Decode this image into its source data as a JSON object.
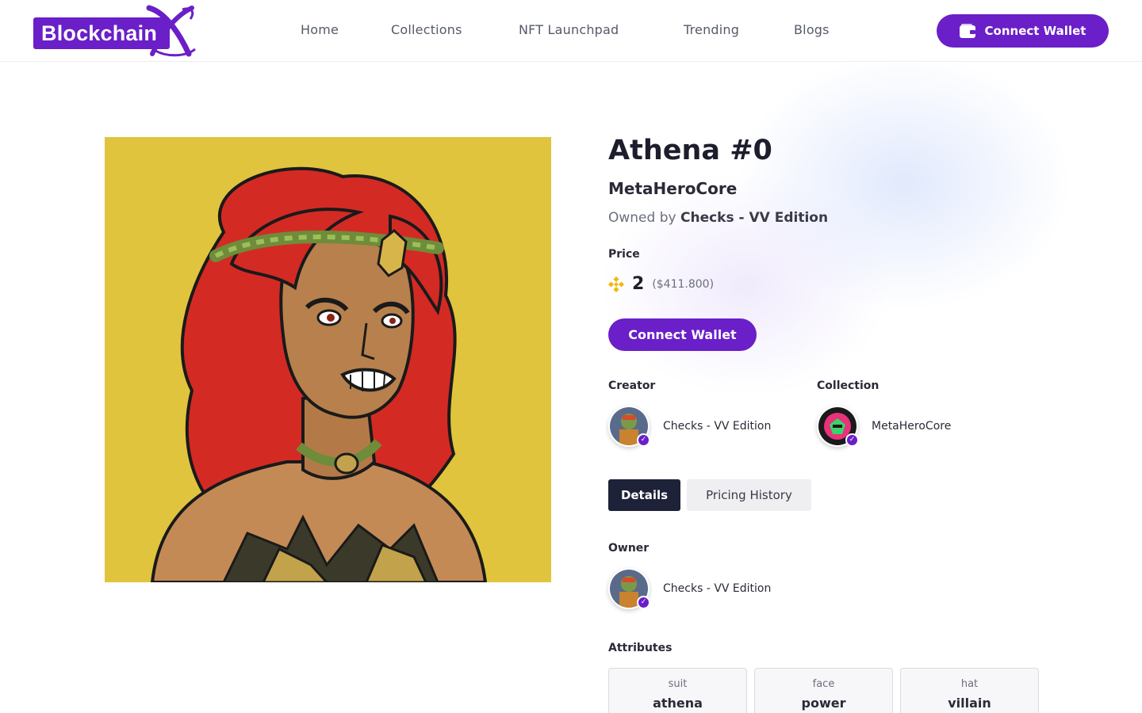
{
  "header": {
    "logo_text": "Blockchain",
    "nav": [
      "Home",
      "Collections",
      "NFT Launchpad",
      "Trending",
      "Blogs"
    ],
    "connect_wallet_label": "Connect Wallet"
  },
  "nft": {
    "title": "Athena #0",
    "collection": "MetaHeroCore",
    "owned_by_prefix": "Owned by",
    "owned_by": "Checks - VV Edition",
    "price_label": "Price",
    "price_value": "2",
    "price_usd": "($411.800)",
    "connect_wallet_label": "Connect Wallet"
  },
  "creator": {
    "label": "Creator",
    "name": "Checks - VV Edition"
  },
  "collection_info": {
    "label": "Collection",
    "name": "MetaHeroCore"
  },
  "tabs": [
    {
      "label": "Details",
      "active": true
    },
    {
      "label": "Pricing History",
      "active": false
    }
  ],
  "owner": {
    "label": "Owner",
    "name": "Checks - VV Edition"
  },
  "attributes": {
    "label": "Attributes",
    "items": [
      {
        "key": "suit",
        "value": "athena"
      },
      {
        "key": "face",
        "value": "power"
      },
      {
        "key": "hat",
        "value": "villain"
      }
    ]
  },
  "colors": {
    "accent": "#6a1fc8",
    "artwork_bg": "#e0c43e",
    "tab_active": "#1d2238",
    "currency_icon": "#f0b90b"
  },
  "icons": {
    "wallet": "wallet-icon",
    "currency": "bnb-icon",
    "verified": "verified-check-icon"
  }
}
